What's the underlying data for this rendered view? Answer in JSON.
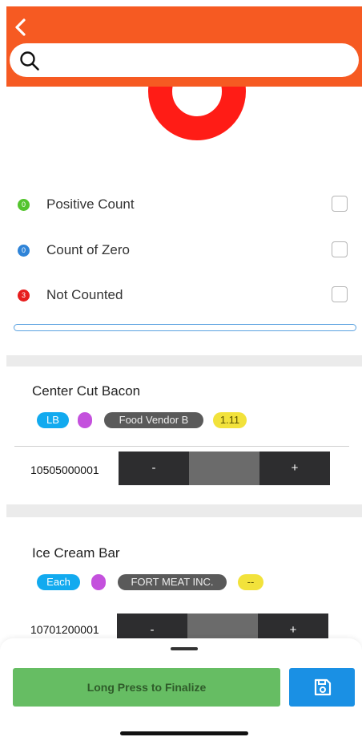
{
  "header": {
    "back_icon": "chevron-left-icon",
    "search_icon": "search-icon",
    "search_value": "",
    "search_placeholder": "",
    "color": "#f65a22"
  },
  "summary": {
    "donut_color": "#ff1c16",
    "legend": [
      {
        "count": "0",
        "label": "Positive Count",
        "color": "#54c42e",
        "checked": false
      },
      {
        "count": "0",
        "label": "Count of Zero",
        "color": "#2f84d8",
        "checked": false
      },
      {
        "count": "3",
        "label": "Not Counted",
        "color": "#e71d1d",
        "checked": false
      }
    ],
    "progress_fraction": 0,
    "progress_color": "#5ba2e0"
  },
  "items": [
    {
      "name": "Center Cut Bacon",
      "unit": "LB",
      "color_tag": "#c451dd",
      "vendor": "Food Vendor B",
      "quantity": "1.11",
      "sku": "10505000001",
      "minus_label": "-",
      "value": "",
      "plus_label": "+"
    },
    {
      "name": "Ice Cream Bar",
      "unit": "Each",
      "color_tag": "#c451dd",
      "vendor": "FORT MEAT INC.",
      "quantity": "--",
      "sku": "10701200001",
      "minus_label": "-",
      "value": "",
      "plus_label": "+"
    }
  ],
  "footer": {
    "finalize_label": "Long Press to Finalize",
    "save_icon": "save-icon",
    "finalize_color": "#66bd63",
    "save_color": "#1a90e4"
  }
}
